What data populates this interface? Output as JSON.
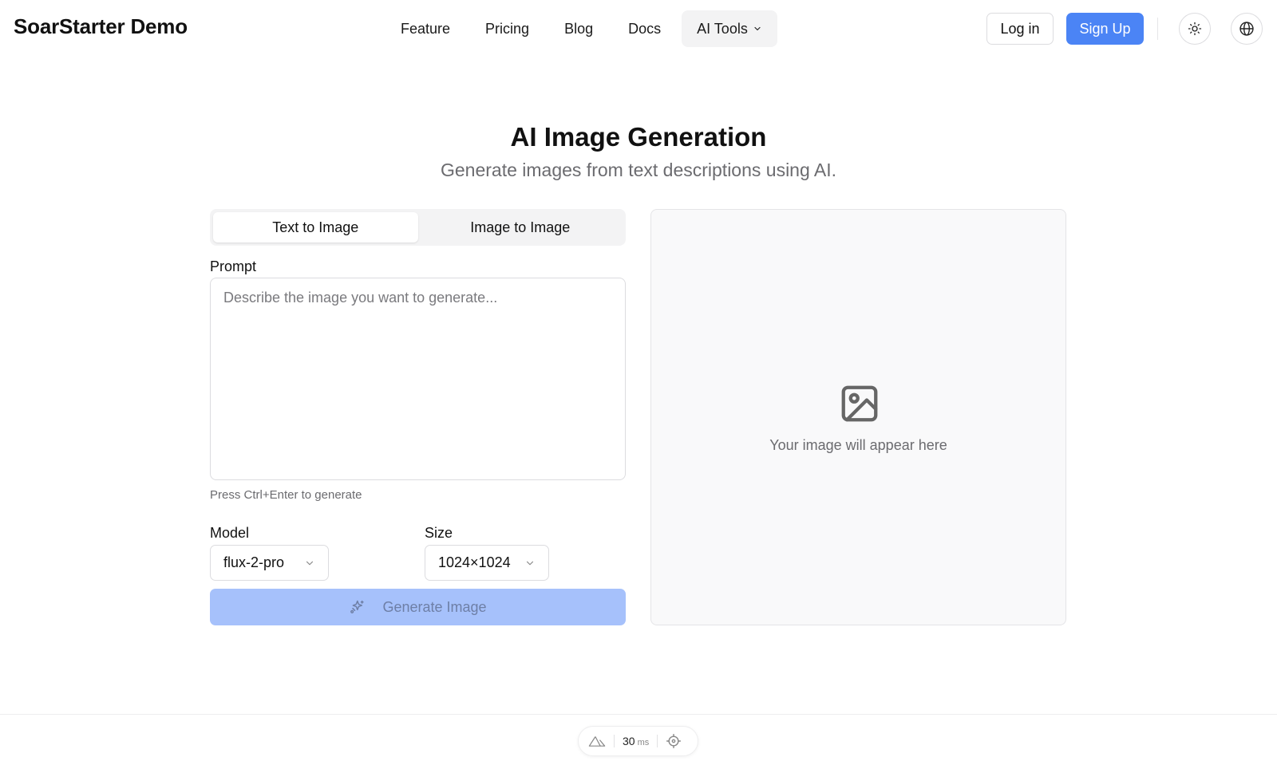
{
  "header": {
    "brand": "SoarStarter Demo",
    "nav": [
      {
        "label": "Feature"
      },
      {
        "label": "Pricing"
      },
      {
        "label": "Blog"
      },
      {
        "label": "Docs"
      },
      {
        "label": "AI Tools",
        "icon": "chevron-down-icon",
        "active": true
      }
    ],
    "login_label": "Log in",
    "signup_label": "Sign Up",
    "theme_icon": "sun-icon",
    "language_icon": "globe-icon"
  },
  "hero": {
    "title": "AI Image Generation",
    "subtitle": "Generate images from text descriptions using AI."
  },
  "form": {
    "tabs": [
      {
        "label": "Text to Image",
        "active": true
      },
      {
        "label": "Image to Image",
        "active": false
      }
    ],
    "prompt": {
      "label": "Prompt",
      "value": "",
      "placeholder": "Describe the image you want to generate..."
    },
    "hint": "Press Ctrl+Enter to generate",
    "model": {
      "label": "Model",
      "value": "flux-2-pro"
    },
    "size": {
      "label": "Size",
      "value": "1024×1024"
    },
    "generate_label": "Generate Image",
    "generate_icon": "sparkles-icon"
  },
  "preview": {
    "icon": "image-placeholder-icon",
    "text": "Your image will appear here"
  },
  "devbar": {
    "logo_icon": "nuxt-logo-icon",
    "time_value": "30",
    "time_unit": "ms",
    "inspect_icon": "crosshair-icon"
  },
  "colors": {
    "accent": "#4b84f5",
    "accent_disabled": "#a6c1fb",
    "muted_text": "#6b6b6f",
    "border": "#dcdcdf"
  }
}
